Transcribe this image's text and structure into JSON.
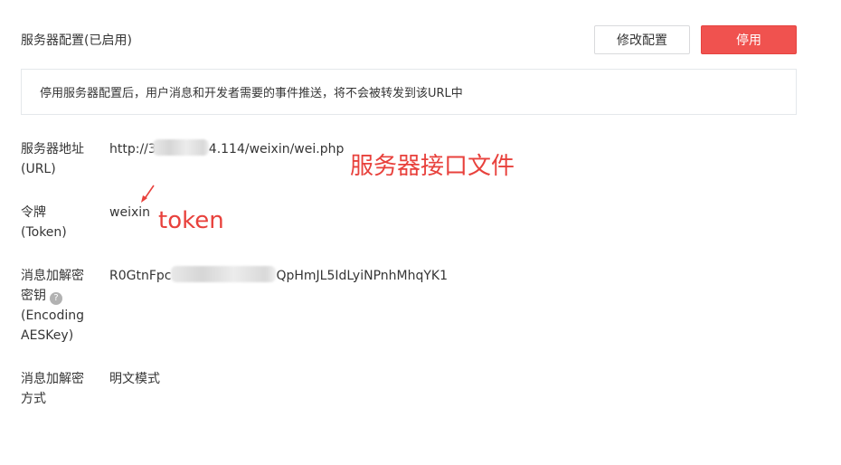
{
  "header": {
    "title": "服务器配置(已启用)",
    "modify_button": "修改配置",
    "disable_button": "停用"
  },
  "notice": {
    "text": "停用服务器配置后，用户消息和开发者需要的事件推送，将不会被转发到该URL中"
  },
  "rows": {
    "url": {
      "label_line1": "服务器地址",
      "label_line2": "(URL)",
      "value_prefix": "http://3",
      "value_suffix": "4.114/weixin/wei.php"
    },
    "token": {
      "label_line1": "令牌",
      "label_line2": "(Token)",
      "value": "weixin"
    },
    "aes": {
      "label_line1": "消息加解密",
      "label_line2": "密钥",
      "label_line3": "(Encoding",
      "label_line4": "AESKey)",
      "value_prefix": "R0GtnFpc",
      "value_suffix": "QpHmJL5IdLyiNPnhMhqYK1"
    },
    "mode": {
      "label_line1": "消息加解密",
      "label_line2": "方式",
      "value": "明文模式"
    }
  },
  "annotations": {
    "server_file": "服务器接口文件",
    "token": "token",
    "color": "#e8413c"
  },
  "icons": {
    "help": "?"
  }
}
